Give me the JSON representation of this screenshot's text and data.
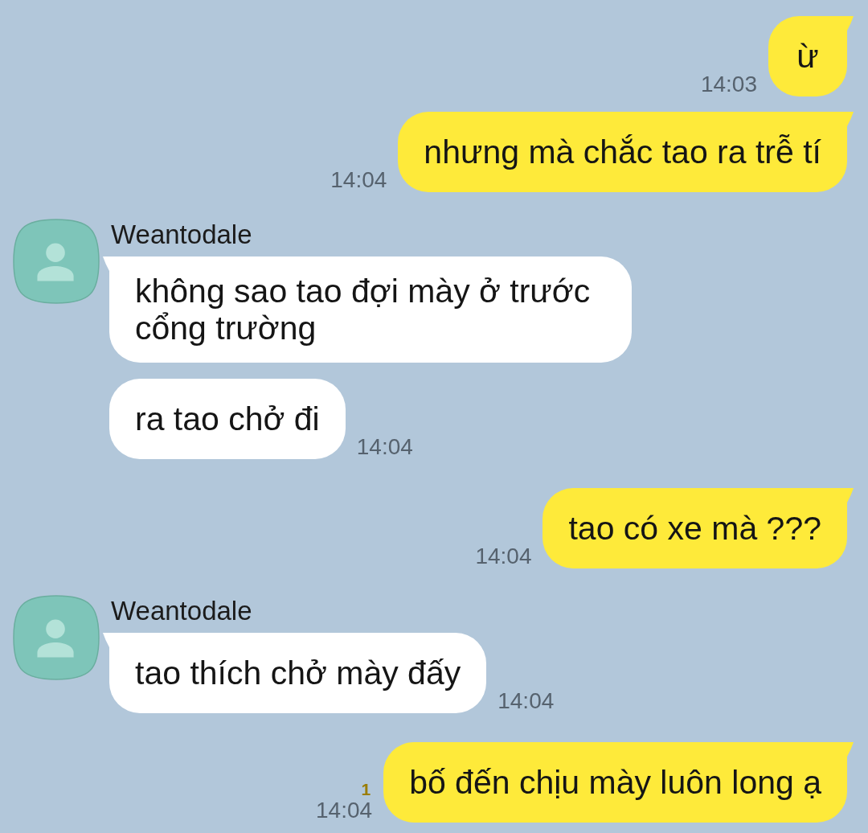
{
  "messages": [
    {
      "kind": "sent",
      "bubbles": [
        {
          "text": "ừ"
        }
      ],
      "time": "14:03"
    },
    {
      "kind": "sent",
      "bubbles": [
        {
          "text": "nhưng mà chắc tao ra trễ tí"
        }
      ],
      "time": "14:04"
    },
    {
      "kind": "received",
      "sender": "Weantodale",
      "bubbles": [
        {
          "text": "không sao tao đợi mày ở trước cổng trường"
        },
        {
          "text": "ra tao chở đi"
        }
      ],
      "time": "14:04"
    },
    {
      "kind": "sent",
      "bubbles": [
        {
          "text": "tao có xe mà ???"
        }
      ],
      "time": "14:04"
    },
    {
      "kind": "received",
      "sender": "Weantodale",
      "bubbles": [
        {
          "text": "tao thích chở mày đấy"
        }
      ],
      "time": "14:04"
    },
    {
      "kind": "sent",
      "bubbles": [
        {
          "text": "bố đến chịu mày luôn long ạ"
        }
      ],
      "time": "14:04",
      "unread": "1"
    }
  ]
}
